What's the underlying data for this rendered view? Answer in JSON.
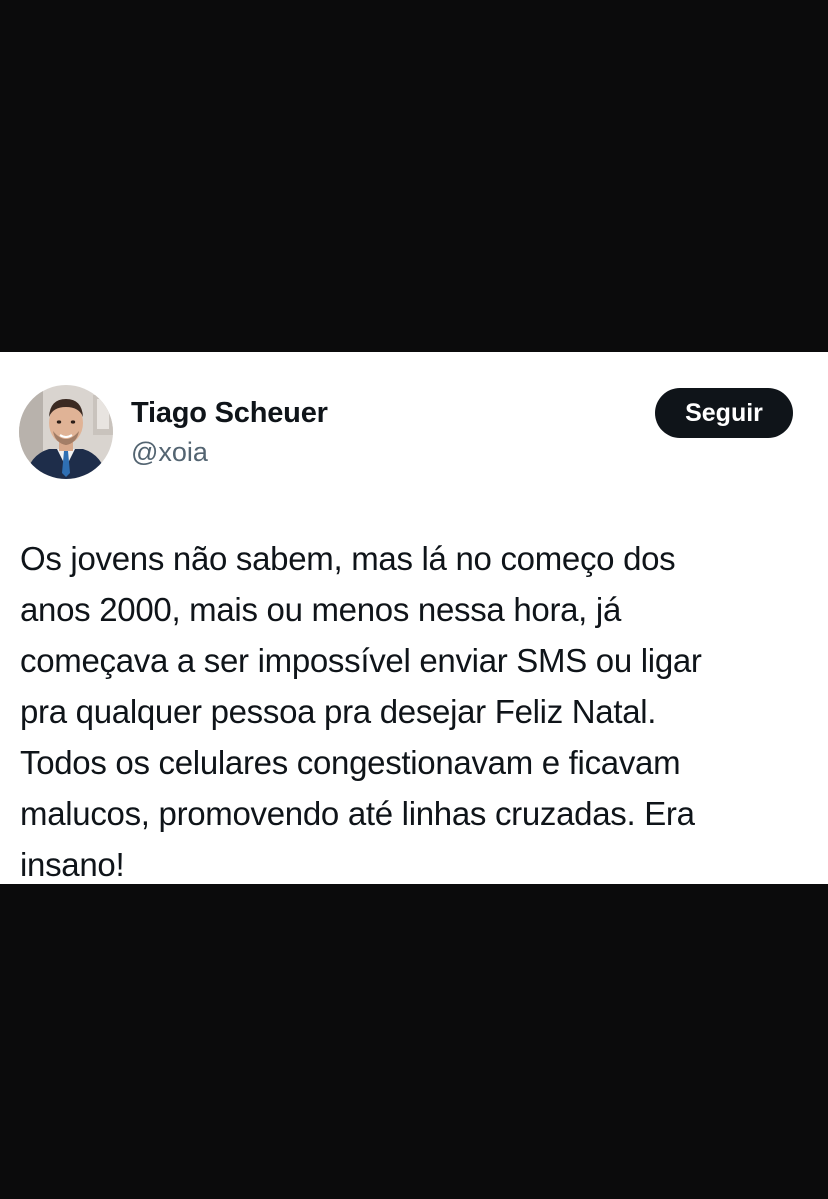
{
  "tweet": {
    "author_name": "Tiago Scheuer",
    "author_handle": "@xoia",
    "follow_label": "Seguir",
    "text_lines": [
      "Os jovens não sabem, mas lá no começo dos",
      "anos 2000, mais ou menos nessa hora, já",
      "começava a ser impossível enviar SMS ou ligar",
      "pra qualquer pessoa pra desejar Feliz Natal.",
      "Todos os celulares congestionavam e ficavam",
      "malucos, promovendo até linhas cruzadas. Era",
      "insano!"
    ]
  },
  "colors": {
    "background": "#0b0b0c",
    "card": "#ffffff",
    "text_primary": "#0f1419",
    "text_secondary": "#536471",
    "button_bg": "#0f1419"
  },
  "icons": {
    "avatar": "profile-photo"
  }
}
